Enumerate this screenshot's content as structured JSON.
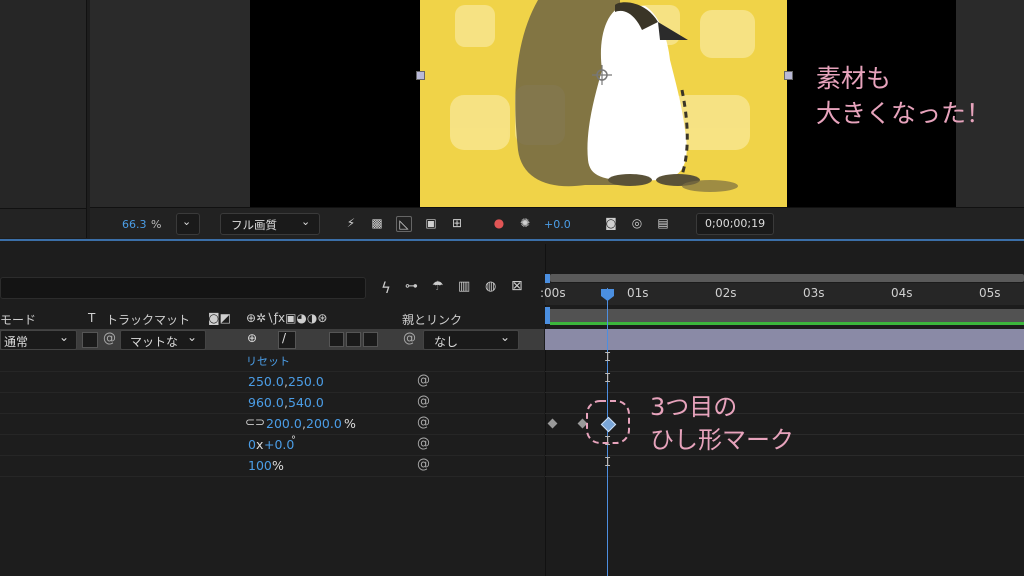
{
  "viewer": {
    "zoom": "66.3",
    "zoom_unit": "%",
    "quality": "フル画質",
    "exposure": "+0.0",
    "timecode": "0;00;00;19"
  },
  "annotations": {
    "top_line1": "素材も",
    "top_line2": "大きくなった！",
    "mid_line1": "3つ目の",
    "mid_line2": "ひし形マーク"
  },
  "timeline": {
    "ruler_ticks": [
      ":00s",
      "01s",
      "02s",
      "03s",
      "04s",
      "05s"
    ],
    "columns": {
      "mode": "モード",
      "t": "T",
      "track_matte": "トラックマット",
      "parent_link": "親とリンク"
    },
    "layer": {
      "mode": "通常",
      "matte": "マットな",
      "parent": "なし"
    },
    "properties": [
      {
        "value": "リセット"
      },
      {
        "value_a": "250.0",
        "sep": ",",
        "value_b": "250.0"
      },
      {
        "value_a": "960.0",
        "sep": ",",
        "value_b": "540.0"
      },
      {
        "value_a": "200.0",
        "sep": ",",
        "value_b": "200.0",
        "unit": "%"
      },
      {
        "value_a": "0",
        "mid": "x",
        "value_b": "+0.0",
        "unit": "°"
      },
      {
        "value_a": "100",
        "unit": "%"
      }
    ]
  },
  "colors": {
    "accent_blue": "#4b9de6",
    "comp_yellow": "#f0d348",
    "annotation_pink": "#e7a3bc",
    "workarea_green": "#3cb53c"
  }
}
